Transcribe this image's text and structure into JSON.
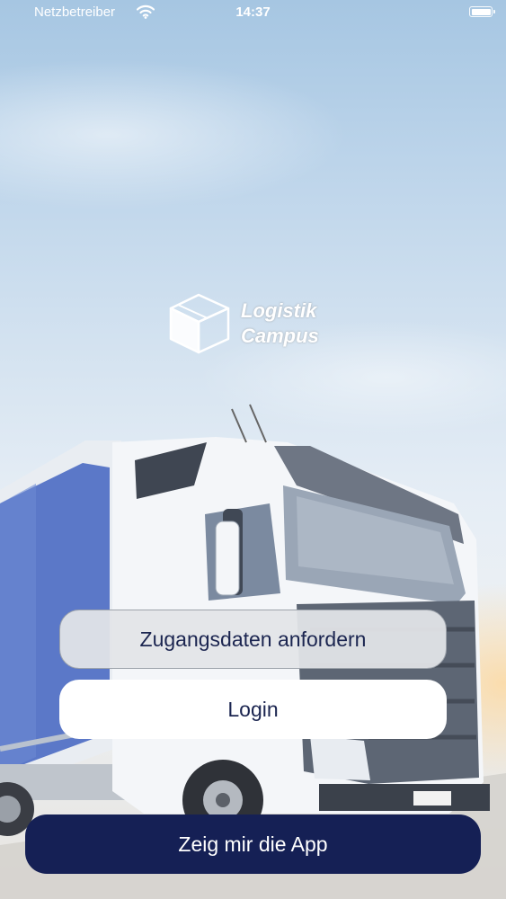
{
  "status_bar": {
    "carrier": "Netzbetreiber",
    "time": "14:37",
    "icons": [
      "wifi-icon",
      "battery-icon"
    ]
  },
  "logo": {
    "line1": "Logistik",
    "line2": "Campus",
    "icon": "cube-icon"
  },
  "buttons": {
    "request_access": "Zugangsdaten anfordern",
    "login": "Login",
    "show_app": "Zeig mir die App"
  },
  "colors": {
    "primary": "#152055",
    "button_text": "#1b2550",
    "secondary_button_bg": "#e2e4e8",
    "login_button_bg": "#ffffff"
  }
}
